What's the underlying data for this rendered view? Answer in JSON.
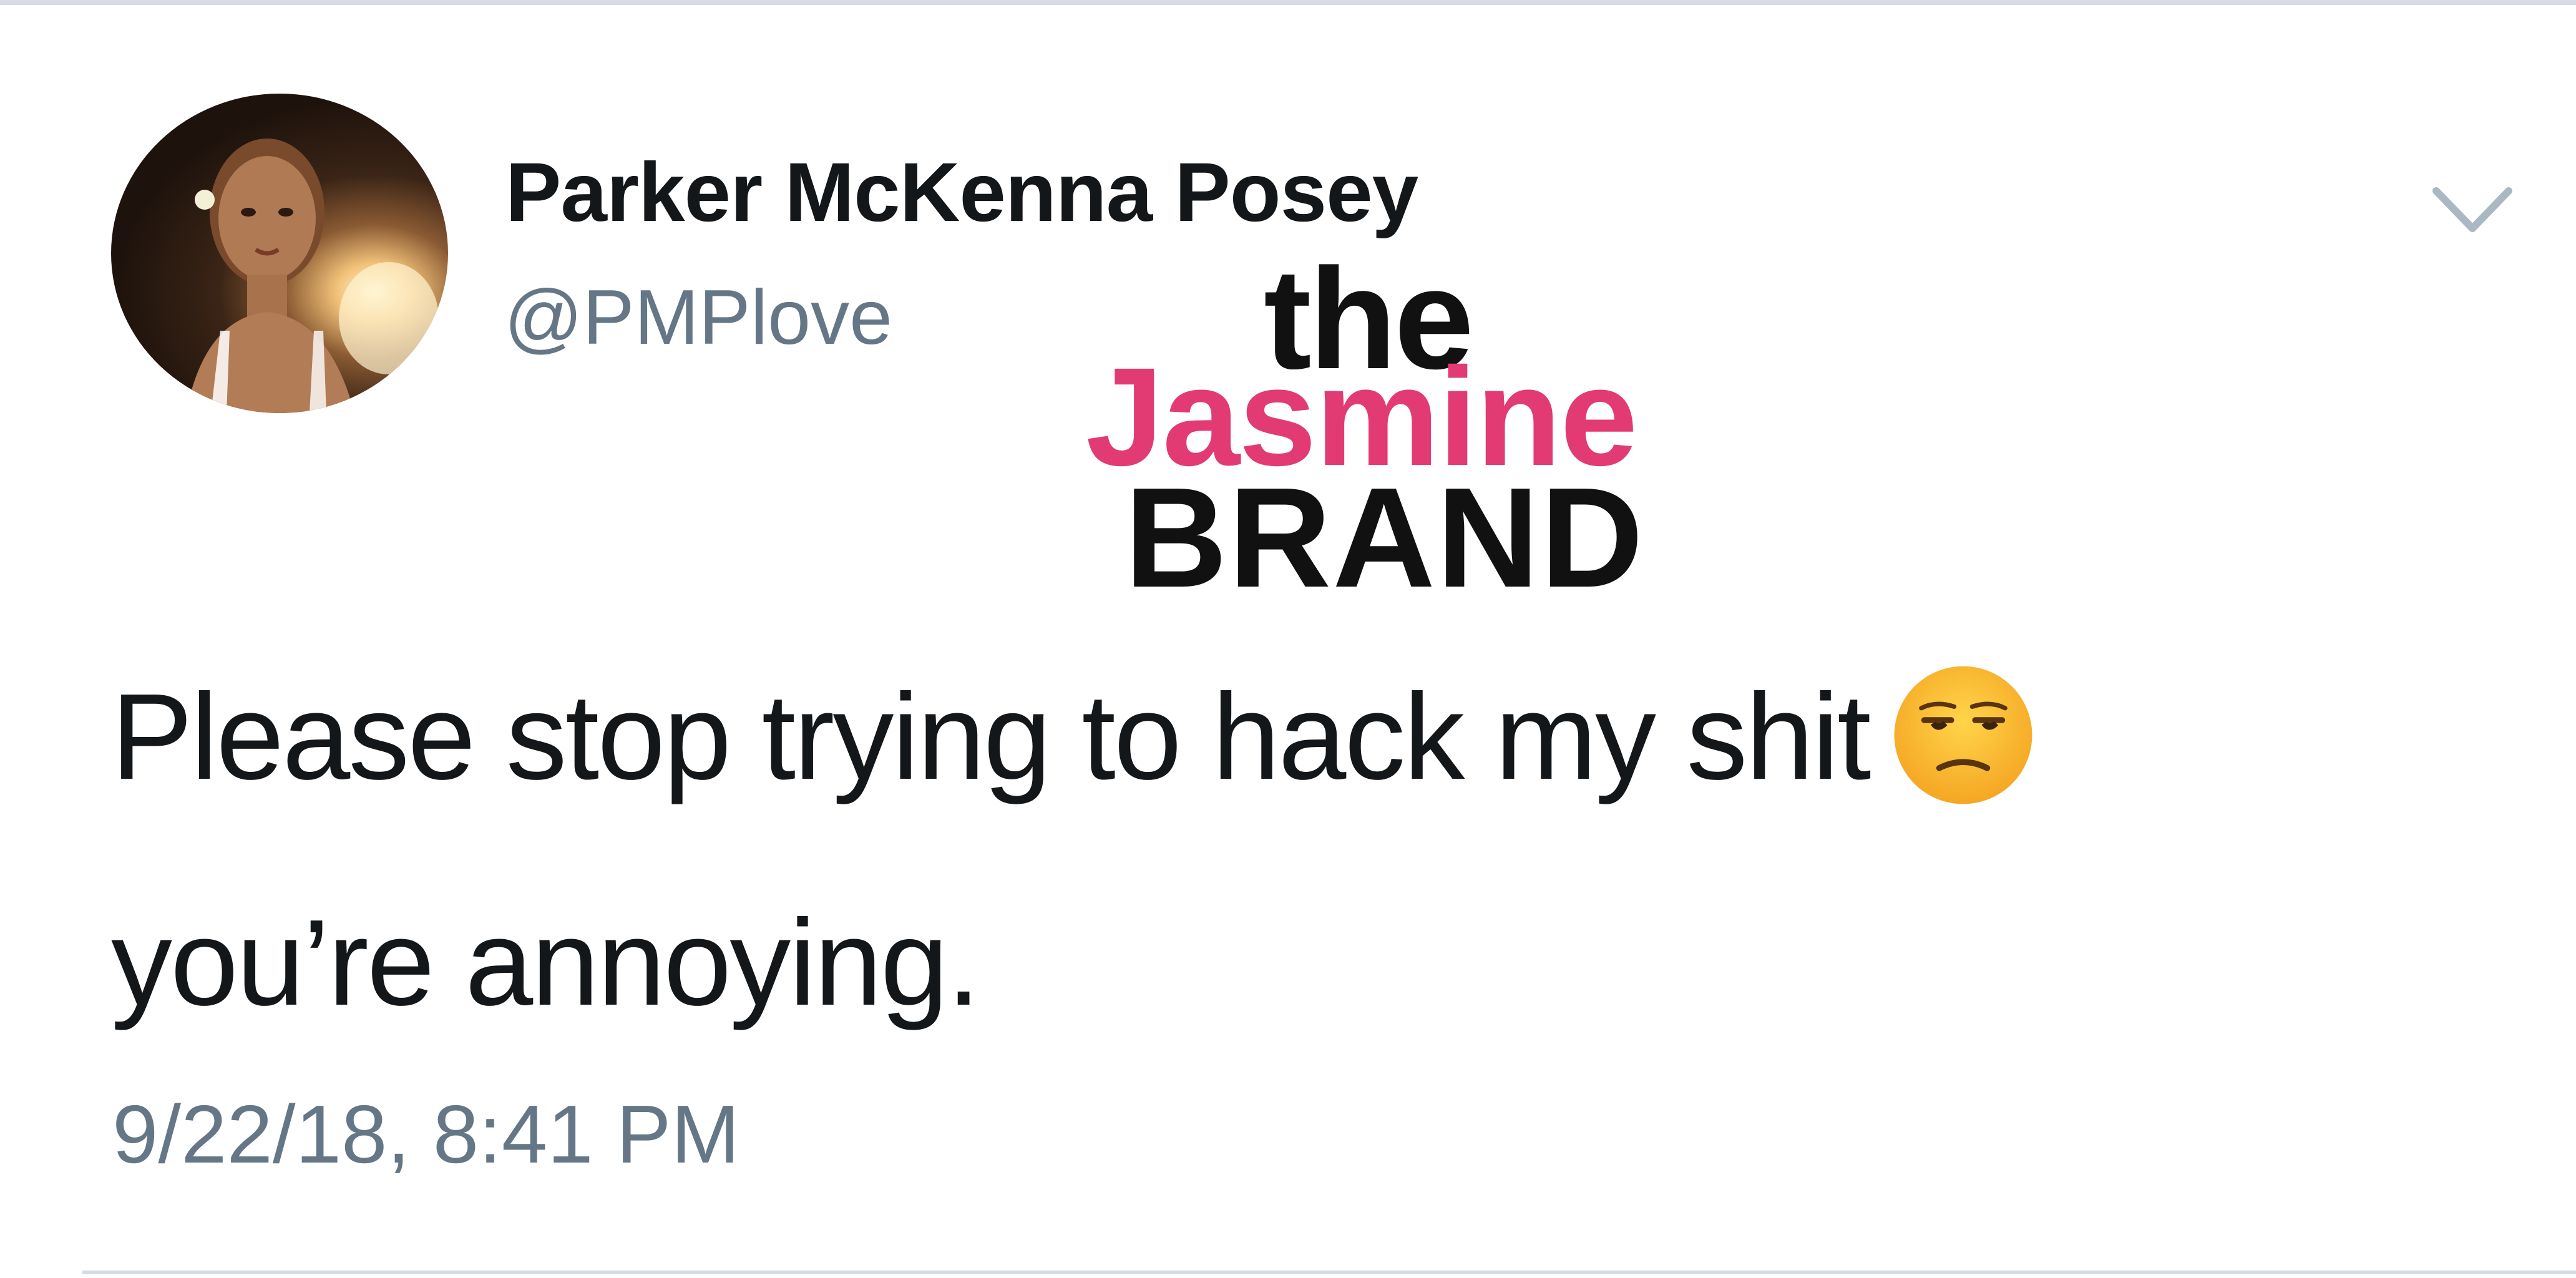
{
  "tweet": {
    "display_name": "Parker McKenna Posey",
    "handle": "@PMPlove",
    "text_line_1": "Please stop trying to hack my shit",
    "text_line_2": "you’re annoying.",
    "timestamp": "9/22/18, 8:41 PM",
    "emoji": "unamused-face-icon",
    "avatar": "profile-photo"
  },
  "watermark": {
    "the": "the",
    "jasmine": "Jasmine",
    "brand": "BRAND",
    "accent_color": "#e23a72"
  },
  "menu": {
    "icon": "chevron-down-icon"
  },
  "colors": {
    "text_primary": "#14171a",
    "text_secondary": "#657786",
    "divider": "#d6dce2"
  }
}
